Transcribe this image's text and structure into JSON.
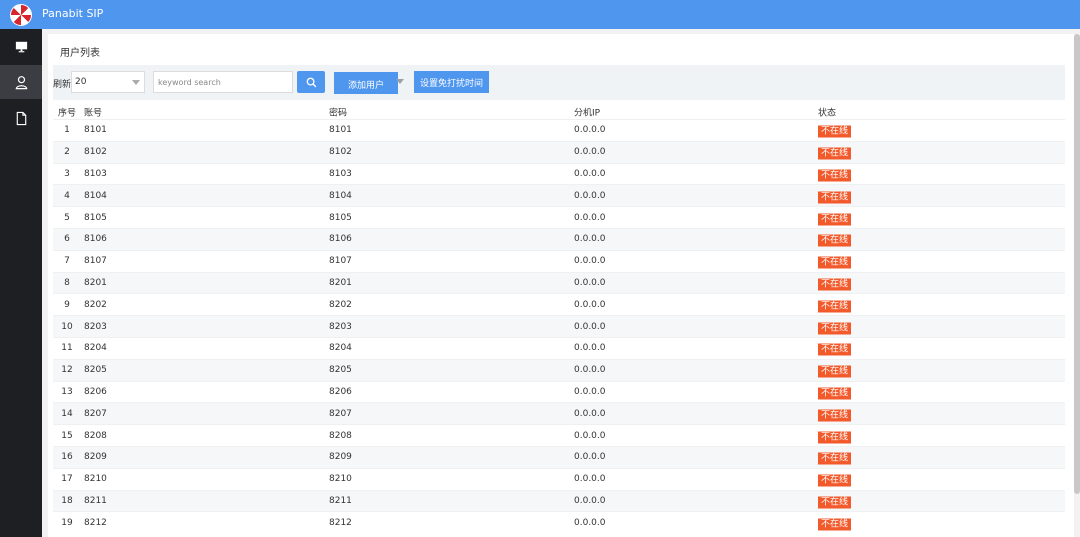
{
  "app": {
    "title": "Panabit SIP"
  },
  "page": {
    "title": "用户列表"
  },
  "toolbar": {
    "refresh_label": "刷新",
    "refresh_value": "20",
    "search_placeholder": "keyword search",
    "add_user_label": "添加用户",
    "dnd_label": "设置免打扰时间"
  },
  "table": {
    "headers": {
      "no": "序号",
      "account": "账号",
      "password": "密码",
      "ip": "分机IP",
      "status": "状态"
    },
    "rows": [
      {
        "no": "1",
        "account": "8101",
        "password": "8101",
        "ip": "0.0.0.0",
        "status": "不在线"
      },
      {
        "no": "2",
        "account": "8102",
        "password": "8102",
        "ip": "0.0.0.0",
        "status": "不在线"
      },
      {
        "no": "3",
        "account": "8103",
        "password": "8103",
        "ip": "0.0.0.0",
        "status": "不在线"
      },
      {
        "no": "4",
        "account": "8104",
        "password": "8104",
        "ip": "0.0.0.0",
        "status": "不在线"
      },
      {
        "no": "5",
        "account": "8105",
        "password": "8105",
        "ip": "0.0.0.0",
        "status": "不在线"
      },
      {
        "no": "6",
        "account": "8106",
        "password": "8106",
        "ip": "0.0.0.0",
        "status": "不在线"
      },
      {
        "no": "7",
        "account": "8107",
        "password": "8107",
        "ip": "0.0.0.0",
        "status": "不在线"
      },
      {
        "no": "8",
        "account": "8201",
        "password": "8201",
        "ip": "0.0.0.0",
        "status": "不在线"
      },
      {
        "no": "9",
        "account": "8202",
        "password": "8202",
        "ip": "0.0.0.0",
        "status": "不在线"
      },
      {
        "no": "10",
        "account": "8203",
        "password": "8203",
        "ip": "0.0.0.0",
        "status": "不在线"
      },
      {
        "no": "11",
        "account": "8204",
        "password": "8204",
        "ip": "0.0.0.0",
        "status": "不在线"
      },
      {
        "no": "12",
        "account": "8205",
        "password": "8205",
        "ip": "0.0.0.0",
        "status": "不在线"
      },
      {
        "no": "13",
        "account": "8206",
        "password": "8206",
        "ip": "0.0.0.0",
        "status": "不在线"
      },
      {
        "no": "14",
        "account": "8207",
        "password": "8207",
        "ip": "0.0.0.0",
        "status": "不在线"
      },
      {
        "no": "15",
        "account": "8208",
        "password": "8208",
        "ip": "0.0.0.0",
        "status": "不在线"
      },
      {
        "no": "16",
        "account": "8209",
        "password": "8209",
        "ip": "0.0.0.0",
        "status": "不在线"
      },
      {
        "no": "17",
        "account": "8210",
        "password": "8210",
        "ip": "0.0.0.0",
        "status": "不在线"
      },
      {
        "no": "18",
        "account": "8211",
        "password": "8211",
        "ip": "0.0.0.0",
        "status": "不在线"
      },
      {
        "no": "19",
        "account": "8212",
        "password": "8212",
        "ip": "0.0.0.0",
        "status": "不在线"
      }
    ]
  },
  "icons": {
    "sidebar": [
      "monitor-icon",
      "user-icon",
      "document-icon"
    ],
    "search": "search-icon"
  },
  "colors": {
    "primary": "#4f96ee",
    "status_offline": "#f25a2b",
    "sidebar_bg": "#1e1f22"
  }
}
